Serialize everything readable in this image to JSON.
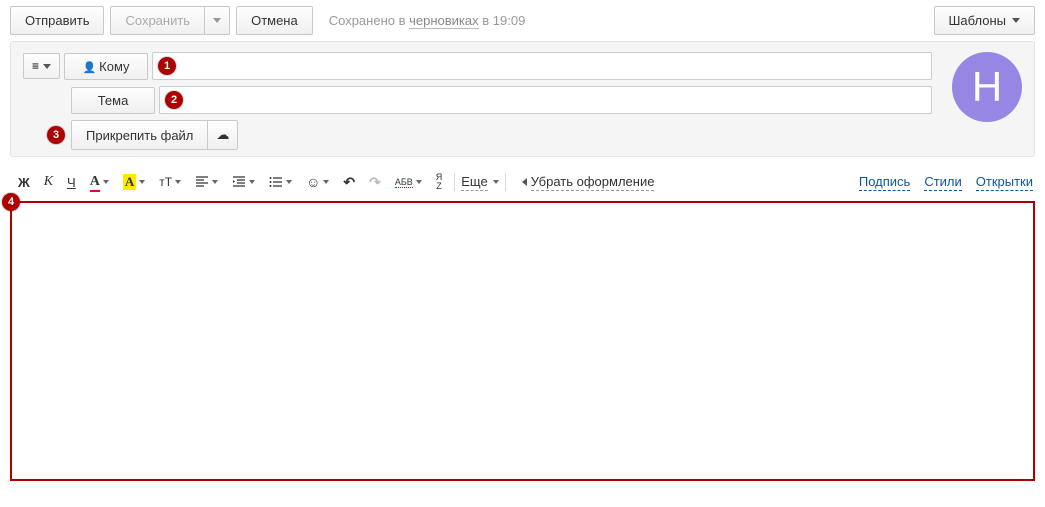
{
  "actions": {
    "send": "Отправить",
    "save": "Сохранить",
    "cancel": "Отмена",
    "templates": "Шаблоны"
  },
  "status": {
    "prefix": "Сохранено в ",
    "drafts": "черновиках",
    "suffix": " в 19:09"
  },
  "fields": {
    "to_label": "Кому",
    "subject_label": "Тема",
    "to_value": "",
    "subject_value": ""
  },
  "attach": {
    "label": "Прикрепить файл"
  },
  "avatar": {
    "initial": "Н"
  },
  "markers": {
    "m1": "1",
    "m2": "2",
    "m3": "3",
    "m4": "4"
  },
  "toolbar": {
    "bold": "Ж",
    "italic": "К",
    "underline": "Ч",
    "color": "А",
    "bg": "А",
    "size": "тТ",
    "smile": "☺",
    "undo": "↶",
    "redo": "↷",
    "spell": "АБВ",
    "translit": "Я\nZ",
    "more": "Еще",
    "clear": "Убрать оформление",
    "signature": "Подпись",
    "styles": "Стили",
    "postcards": "Открытки"
  }
}
